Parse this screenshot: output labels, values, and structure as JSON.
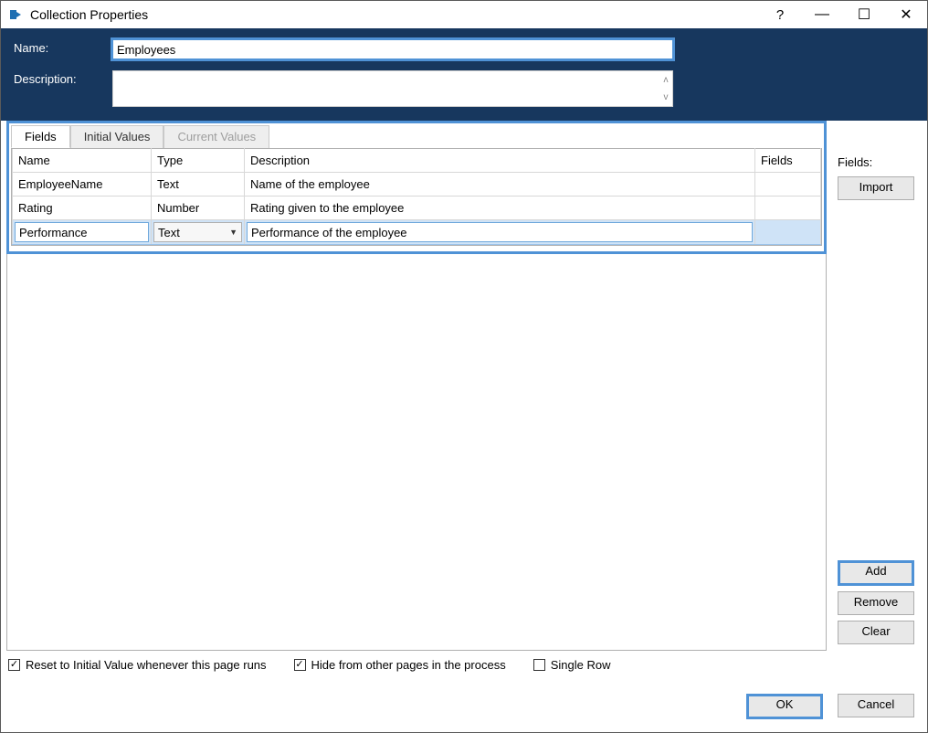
{
  "window": {
    "title": "Collection Properties",
    "help": "?",
    "min": "—",
    "max": "☐",
    "close": "✕"
  },
  "header": {
    "name_label": "Name:",
    "name_value": "Employees",
    "desc_label": "Description:",
    "desc_value": ""
  },
  "tabs": {
    "fields": "Fields",
    "initial": "Initial Values",
    "current": "Current Values"
  },
  "table": {
    "cols": {
      "name": "Name",
      "type": "Type",
      "desc": "Description",
      "fields": "Fields"
    },
    "rows": [
      {
        "name": "EmployeeName",
        "type": "Text",
        "desc": "Name of the employee",
        "fields": ""
      },
      {
        "name": "Rating",
        "type": "Number",
        "desc": "Rating given to the employee",
        "fields": ""
      }
    ],
    "editing": {
      "name": "Performance",
      "type": "Text",
      "desc": "Performance of the employee",
      "fields": ""
    }
  },
  "side": {
    "label": "Fields:",
    "import": "Import",
    "add": "Add",
    "remove": "Remove",
    "clear": "Clear"
  },
  "checks": {
    "reset": "Reset to Initial Value whenever this page runs",
    "hide": "Hide from other pages in the process",
    "single": "Single Row",
    "reset_checked": true,
    "hide_checked": true,
    "single_checked": false
  },
  "footer": {
    "ok": "OK",
    "cancel": "Cancel"
  }
}
